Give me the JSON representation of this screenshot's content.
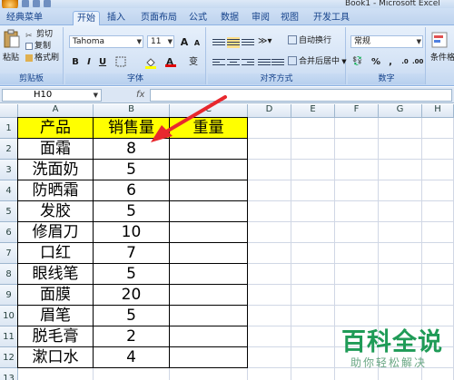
{
  "window": {
    "title": "Book1 - Microsoft Excel"
  },
  "tabs": [
    "经典菜单",
    "开始",
    "插入",
    "页面布局",
    "公式",
    "数据",
    "审阅",
    "视图",
    "开发工具"
  ],
  "active_tab": "开始",
  "ribbon": {
    "clipboard": {
      "paste": "粘贴",
      "cut": "剪切",
      "copy": "复制",
      "format_painter": "格式刷",
      "label": "剪贴板"
    },
    "font": {
      "name": "Tahoma",
      "size": "11",
      "grow": "A",
      "shrink": "A",
      "bold": "B",
      "italic": "I",
      "underline": "U",
      "font_color_letter": "A",
      "wen": "变",
      "label": "字体",
      "fill_color": "#ffff00",
      "font_color": "#e00000"
    },
    "alignment": {
      "wrap": "自动换行",
      "merge": "合并后居中",
      "label": "对齐方式"
    },
    "number": {
      "format": "常规",
      "percent": "%",
      "comma": ",",
      "label": "数字"
    },
    "styles": {
      "conditional": "条件格"
    }
  },
  "formula_bar": {
    "name_box": "H10",
    "fx": "fx",
    "value": ""
  },
  "columns": [
    "A",
    "B",
    "C",
    "D",
    "E",
    "F",
    "G",
    "H"
  ],
  "rows": [
    "1",
    "2",
    "3",
    "4",
    "5",
    "6",
    "7",
    "8",
    "9",
    "10",
    "11",
    "12",
    "13"
  ],
  "table": {
    "headers": [
      "产品",
      "销售量",
      "重量"
    ],
    "rows": [
      [
        "面霜",
        "8",
        ""
      ],
      [
        "洗面奶",
        "5",
        ""
      ],
      [
        "防晒霜",
        "6",
        ""
      ],
      [
        "发胶",
        "5",
        ""
      ],
      [
        "修眉刀",
        "10",
        ""
      ],
      [
        "口红",
        "7",
        ""
      ],
      [
        "眼线笔",
        "5",
        ""
      ],
      [
        "面膜",
        "20",
        ""
      ],
      [
        "眉笔",
        "5",
        ""
      ],
      [
        "脱毛膏",
        "2",
        ""
      ],
      [
        "漱口水",
        "4",
        ""
      ]
    ],
    "header_fill": "#ffff00"
  },
  "annotation": {
    "arrow_color": "#e8282e"
  },
  "watermark": {
    "title": "百科全说",
    "subtitle": "助你轻松解决"
  }
}
